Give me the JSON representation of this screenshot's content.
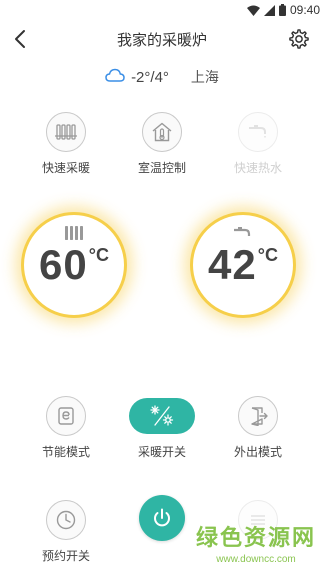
{
  "status_bar": {
    "time": "09:40"
  },
  "header": {
    "title": "我家的采暖炉"
  },
  "weather": {
    "temperature": "-2°/4°",
    "city": "上海"
  },
  "top_functions": [
    {
      "label": "快速采暖",
      "enabled": true
    },
    {
      "label": "室温控制",
      "enabled": true
    },
    {
      "label": "快速热水",
      "enabled": false
    }
  ],
  "gauges": {
    "heating": {
      "value": "60",
      "unit": "°C"
    },
    "hot_water": {
      "value": "42",
      "unit": "°C"
    }
  },
  "mode_functions": [
    {
      "label": "节能模式"
    },
    {
      "label": "采暖开关",
      "active": true
    },
    {
      "label": "外出模式"
    }
  ],
  "bottom_functions": [
    {
      "label": "预约开关"
    }
  ],
  "watermark": {
    "title": "绿色资源网",
    "url": "www.downcc.com"
  },
  "colors": {
    "accent": "#2fb5a4",
    "glow": "#f6cf4a",
    "weather_icon": "#3a8ee6"
  }
}
